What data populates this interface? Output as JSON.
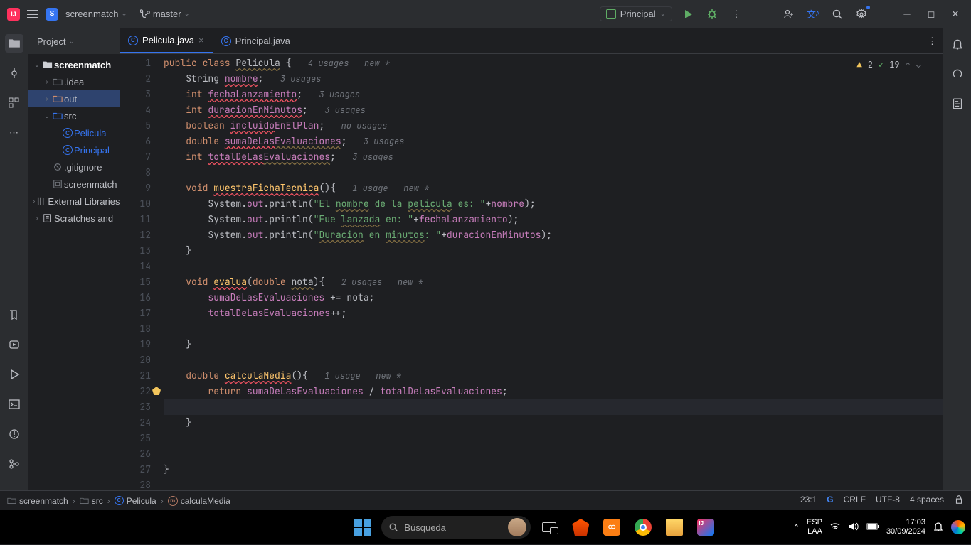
{
  "titlebar": {
    "project_label": "screenmatch",
    "branch_label": "master",
    "run_config": "Principal"
  },
  "project_panel": {
    "header": "Project",
    "tree": [
      {
        "depth": 0,
        "arrow": "v",
        "icon": "folder",
        "label": "screenmatch",
        "bold": true
      },
      {
        "depth": 1,
        "arrow": ">",
        "icon": "folder-grey",
        "label": ".idea"
      },
      {
        "depth": 1,
        "arrow": ">",
        "icon": "folder-orange",
        "label": "out",
        "sel": true
      },
      {
        "depth": 1,
        "arrow": "v",
        "icon": "folder-blue",
        "label": "src"
      },
      {
        "depth": 2,
        "arrow": "",
        "icon": "class",
        "label": "Pelicula"
      },
      {
        "depth": 2,
        "arrow": "",
        "icon": "class",
        "label": "Principal"
      },
      {
        "depth": 1,
        "arrow": "",
        "icon": "ignored",
        "label": ".gitignore"
      },
      {
        "depth": 1,
        "arrow": "",
        "icon": "iml",
        "label": "screenmatch"
      },
      {
        "depth": 0,
        "arrow": ">",
        "icon": "lib",
        "label": "External Libraries"
      },
      {
        "depth": 0,
        "arrow": ">",
        "icon": "scratch",
        "label": "Scratches and"
      }
    ]
  },
  "tabs": [
    {
      "label": "Pelicula.java",
      "active": true,
      "closeable": true
    },
    {
      "label": "Principal.java",
      "active": false,
      "closeable": false
    }
  ],
  "inspection": {
    "warn": "2",
    "typo": "19"
  },
  "code_lines": [
    {
      "n": 1,
      "html": "<span class='kw'>public class</span> <span class='warn'>Pelicula</span> {   <span class='hintl'>4 usages   new *</span>"
    },
    {
      "n": 2,
      "html": "    String <span class='fld err'>nombre</span>;   <span class='hintl'>3 usages</span>"
    },
    {
      "n": 3,
      "html": "    <span class='typ'>int</span> <span class='fld err'>fechaLanzamiento</span>;   <span class='hintl'>3 usages</span>"
    },
    {
      "n": 4,
      "html": "    <span class='typ'>int</span> <span class='fld err'>duracionEnMinutos</span>;   <span class='hintl'>3 usages</span>"
    },
    {
      "n": 5,
      "html": "    <span class='typ'>boolean</span> <span class='fld err'>incluido</span><span class='fld'>EnElPlan</span>;   <span class='hintl'>no usages</span>"
    },
    {
      "n": 6,
      "html": "    <span class='typ'>double</span> <span class='fld err'>sumaDeLas</span><span class='fld warn'>Evaluaciones</span>;   <span class='hintl'>3 usages</span>"
    },
    {
      "n": 7,
      "html": "    <span class='typ'>int</span> <span class='fld err'>totalDeLas</span><span class='fld warn'>Evaluaciones</span>;   <span class='hintl'>3 usages</span>"
    },
    {
      "n": 8,
      "html": ""
    },
    {
      "n": 9,
      "html": "    <span class='typ'>void</span> <span class='mth err'>muestraFichaTecnica</span>(){   <span class='hintl'>1 usage   new *</span>"
    },
    {
      "n": 10,
      "html": "        System.<span class='fld'>out</span>.println(<span class='str'>\"El <span class='warn'>nombre</span> de la <span class='warn'>pelicula</span> es: \"</span>+<span class='fld'>nombre</span>);"
    },
    {
      "n": 11,
      "html": "        System.<span class='fld'>out</span>.println(<span class='str'>\"Fue <span class='warn'>lanzada</span> en: \"</span>+<span class='fld'>fechaLanzamiento</span>);"
    },
    {
      "n": 12,
      "html": "        System.<span class='fld'>out</span>.println(<span class='str'>\"<span class='warn'>Duracion</span> en <span class='warn'>minutos</span>: \"</span>+<span class='fld'>duracionEnMinutos</span>);"
    },
    {
      "n": 13,
      "html": "    }"
    },
    {
      "n": 14,
      "html": ""
    },
    {
      "n": 15,
      "html": "    <span class='typ'>void</span> <span class='mth err'>evalua</span>(<span class='typ'>double</span> <span class='warn'>nota</span>){   <span class='hintl'>2 usages   new *</span>"
    },
    {
      "n": 16,
      "html": "        <span class='fld'>sumaDeLasEvaluaciones</span> += nota;"
    },
    {
      "n": 17,
      "html": "        <span class='fld'>totalDeLasEvaluaciones</span>++;"
    },
    {
      "n": 18,
      "html": ""
    },
    {
      "n": 19,
      "html": "    }"
    },
    {
      "n": 20,
      "html": ""
    },
    {
      "n": 21,
      "html": "    <span class='typ'>double</span> <span class='mth err'>calculaMedia</span>(){   <span class='hintl'>1 usage   new *</span>"
    },
    {
      "n": 22,
      "html": "        <span class='kw'>return</span> <span class='fld'>sumaDeLasEvaluaciones</span> / <span class='fld'>totalDeLasEvaluaciones</span>;",
      "bulb": true
    },
    {
      "n": 23,
      "html": "",
      "cur": true
    },
    {
      "n": 24,
      "html": "    }"
    },
    {
      "n": 25,
      "html": ""
    },
    {
      "n": 26,
      "html": ""
    },
    {
      "n": 27,
      "html": "}"
    },
    {
      "n": 28,
      "html": ""
    }
  ],
  "breadcrumb": {
    "items": [
      {
        "icon": "folder",
        "label": "screenmatch"
      },
      {
        "icon": "folder",
        "label": "src"
      },
      {
        "icon": "class",
        "label": "Pelicula"
      },
      {
        "icon": "method",
        "label": "calculaMedia"
      }
    ],
    "pos": "23:1",
    "enc": "UTF-8",
    "linesep": "CRLF",
    "indent": "4 spaces"
  },
  "taskbar": {
    "search_placeholder": "Búsqueda",
    "lang": "ESP",
    "kbd": "LAA",
    "time": "17:03",
    "date": "30/09/2024"
  }
}
